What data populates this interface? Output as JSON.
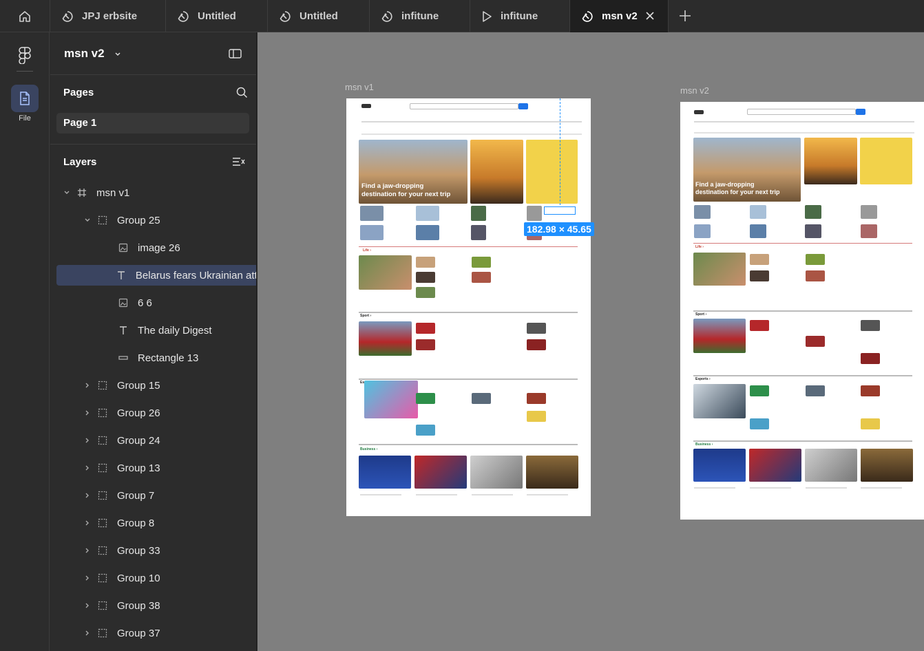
{
  "tabs": [
    {
      "label": "JPJ erbsite",
      "icon": "figma-file-icon"
    },
    {
      "label": "Untitled",
      "icon": "figma-file-icon"
    },
    {
      "label": "Untitled",
      "icon": "figma-file-icon"
    },
    {
      "label": "infitune",
      "icon": "figma-file-icon"
    },
    {
      "label": "infitune",
      "icon": "play-icon"
    },
    {
      "label": "msn v2",
      "icon": "figma-file-icon",
      "active": true
    }
  ],
  "rail": {
    "file_label": "File"
  },
  "panel": {
    "project_title": "msn v2",
    "pages_title": "Pages",
    "page_item": "Page 1",
    "layers_title": "Layers"
  },
  "layers": [
    {
      "label": "msn v1",
      "type": "frame",
      "depth": 0,
      "chevron": "down"
    },
    {
      "label": "Group 25",
      "type": "group",
      "depth": 1,
      "chevron": "down"
    },
    {
      "label": "image 26",
      "type": "image",
      "depth": 2
    },
    {
      "label": "Belarus fears Ukrainian atta",
      "type": "text",
      "depth": 2,
      "selected": true
    },
    {
      "label": "6 6",
      "type": "image",
      "depth": 2
    },
    {
      "label": "The daily Digest",
      "type": "text",
      "depth": 2
    },
    {
      "label": "Rectangle 13",
      "type": "rect",
      "depth": 2
    },
    {
      "label": "Group 15",
      "type": "group",
      "depth": 1,
      "chevron": "right"
    },
    {
      "label": "Group 26",
      "type": "group",
      "depth": 1,
      "chevron": "right"
    },
    {
      "label": "Group 24",
      "type": "group",
      "depth": 1,
      "chevron": "right"
    },
    {
      "label": "Group 13",
      "type": "group",
      "depth": 1,
      "chevron": "right"
    },
    {
      "label": "Group 7",
      "type": "group",
      "depth": 1,
      "chevron": "right"
    },
    {
      "label": "Group 8",
      "type": "group",
      "depth": 1,
      "chevron": "right"
    },
    {
      "label": "Group 33",
      "type": "group",
      "depth": 1,
      "chevron": "right"
    },
    {
      "label": "Group 10",
      "type": "group",
      "depth": 1,
      "chevron": "right"
    },
    {
      "label": "Group 38",
      "type": "group",
      "depth": 1,
      "chevron": "right"
    },
    {
      "label": "Group 37",
      "type": "group",
      "depth": 1,
      "chevron": "right"
    }
  ],
  "canvas": {
    "frame1_label": "msn v1",
    "frame2_label": "msn v2",
    "hero_caption_line1": "Find a jaw-dropping",
    "hero_caption_line2": "destination for your next trip",
    "selection_dimensions": "182.98 × 45.65",
    "section_life": "Life ›",
    "section_sport": "Sport ›",
    "section_esports": "Esports ›",
    "section_business": "Business ›"
  },
  "colors": {
    "accent": "#1e90ff",
    "selection": "#3a4460",
    "canvas_bg": "#7f7f7f",
    "panel_bg": "#2c2c2c"
  }
}
